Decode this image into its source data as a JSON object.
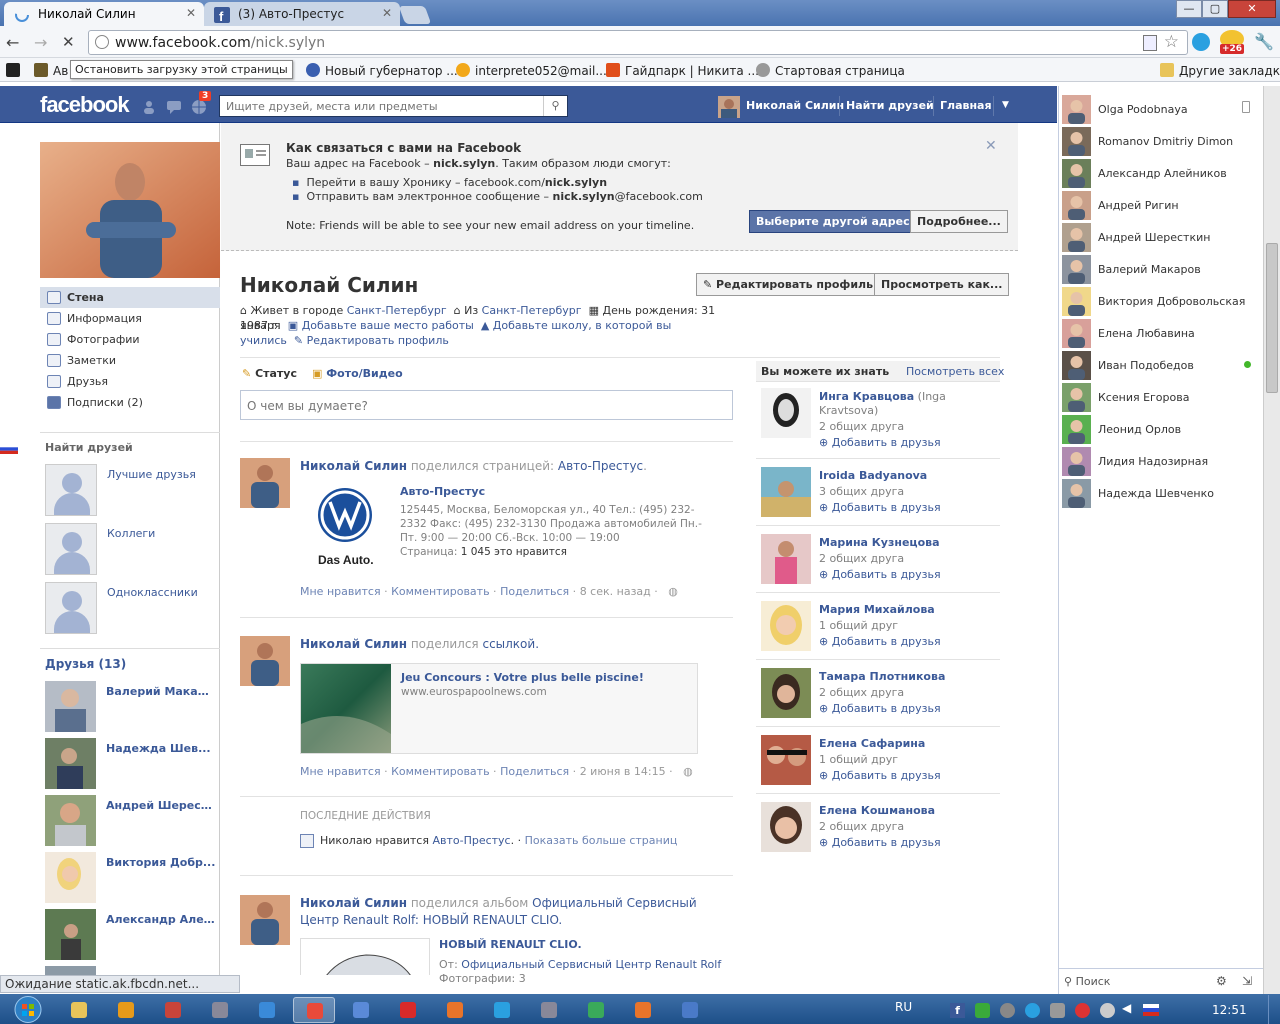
{
  "browser": {
    "tabs": [
      {
        "title": "Николай Силин"
      },
      {
        "title": "(3) Авто-Престус"
      }
    ],
    "url_host": "www.facebook.com",
    "url_path": "/nick.sylyn",
    "tooltip": "Остановить загрузку этой страницы",
    "badge": "+26",
    "bookmarks": [
      {
        "label": "Ав",
        "icon": "wordmark-icon"
      },
      {
        "label": "ин",
        "icon": "page-icon"
      },
      {
        "label": "Новый губернатор ...",
        "icon": "eye-icon"
      },
      {
        "label": "interprete052@mail....",
        "icon": "mail-icon"
      },
      {
        "label": "Гайдпарк | Никита ...",
        "icon": "gaidpark-icon"
      },
      {
        "label": "Стартовая страница",
        "icon": "start-icon"
      }
    ],
    "other_bookmarks": "Другие закладки",
    "status_text": "Ожидание static.ak.fbcdn.net..."
  },
  "fb": {
    "logo": "facebook",
    "notif_count": "3",
    "search_placeholder": "Ищите друзей, места или предметы",
    "nav": {
      "user": "Николай Силин",
      "find_friends": "Найти друзей",
      "home": "Главная"
    }
  },
  "left": {
    "nav": [
      {
        "label": "Стена"
      },
      {
        "label": "Информация"
      },
      {
        "label": "Фотографии"
      },
      {
        "label": "Заметки"
      },
      {
        "label": "Друзья"
      },
      {
        "label": "Подписки (2)"
      }
    ],
    "find_friends_heading": "Найти друзей",
    "lists": [
      {
        "label": "Лучшие друзья"
      },
      {
        "label": "Коллеги"
      },
      {
        "label": "Одноклассники"
      }
    ],
    "friends_heading": "Друзья (13)",
    "friends": [
      {
        "name": "Валерий Макаров"
      },
      {
        "name": "Надежда Шев..."
      },
      {
        "name": "Андрей Шерест..."
      },
      {
        "name": "Виктория Добр..."
      },
      {
        "name": "Александр Але..."
      }
    ]
  },
  "notice": {
    "title": "Как связаться с вами на Facebook",
    "line1_pre": "Ваш адрес на Facebook – ",
    "line1_bold": "nick.sylyn",
    "line1_post": ". Таким образом люди смогут:",
    "bullet1_pre": "Перейти в вашу Хронику – facebook.com/",
    "bullet1_bold": "nick.sylyn",
    "bullet2_pre": "Отправить вам электронное сообщение – ",
    "bullet2_bold": "nick.sylyn",
    "bullet2_post": "@facebook.com",
    "note": "Note: Friends will be able to see your new email address on your timeline.",
    "btn_other": "Выберите другой адрес",
    "btn_more": "Подробнее..."
  },
  "profile": {
    "name": "Николай Силин",
    "edit_btn": "Редактировать профиль",
    "view_btn": "Просмотреть как...",
    "lives_pre": "Живет в городе ",
    "lives_city": "Санкт-Петербург",
    "from_pre": "Из ",
    "from_city": "Санкт-Петербург",
    "birthday": "День рождения: 31 января",
    "year": "1987 г.",
    "add_work": "Добавьте ваше место работы",
    "add_school_1": "Добавьте школу, в которой вы",
    "add_school_2": "учились",
    "edit_profile": "Редактировать профиль"
  },
  "composer": {
    "tab_status": "Статус",
    "tab_photo": "Фото/Видео",
    "placeholder": "О чем вы думаете?"
  },
  "posts": [
    {
      "actor": "Николай Силин",
      "verb": " поделился страницей: ",
      "object": "Авто-Престус",
      "attach_title": "Авто-Престус",
      "attach_text": "125445, Москва, Беломорская ул., 40 Тел.: (495) 232-2332 Факс: (495) 232-3130 Продажа автомобилей Пн.-Пт. 9:00 — 20:00 Сб.-Вск. 10:00 — 19:00",
      "attach_page_pre": "Страница: ",
      "attach_page": "1 045 это нравится",
      "logo_text": "Das Auto.",
      "like": "Мне нравится",
      "comment": "Комментировать",
      "share": "Поделиться",
      "time": "8 сек. назад"
    },
    {
      "actor": "Николай Силин",
      "verb": " поделился ",
      "object": "ссылкой.",
      "attach_title": "Jeu Concours : Votre plus belle piscine!",
      "attach_url": "www.eurospapoolnews.com",
      "like": "Мне нравится",
      "comment": "Комментировать",
      "share": "Поделиться",
      "time": "2 июня в 14:15"
    },
    {
      "actor": "Николай Силин",
      "verb": " поделился альбом ",
      "object": "Официальный Сервисный Центр Renault Rolf: НОВЫЙ RENAULT CLIO.",
      "object_l1": "Официальный Сервисный",
      "object_l2": "Центр Renault Rolf: НОВЫЙ RENAULT CLIO.",
      "attach_title": "НОВЫЙ RENAULT CLIO.",
      "from_pre": "От: ",
      "from": "Официальный Сервисный Центр Renault Rolf",
      "photos": "Фотографии: 3"
    }
  ],
  "recent": {
    "heading": "ПОСЛЕДНИЕ ДЕЙСТВИЯ",
    "text_pre": "Николаю нравится ",
    "text_link": "Авто-Престус",
    "text_dot": ".",
    "more": "Показать больше страниц"
  },
  "suggestions": {
    "heading": "Вы можете их знать",
    "see_all": "Посмотреть всех",
    "add_label": "Добавить в друзья",
    "people": [
      {
        "name": "Инга Кравцова",
        "alt": " (Inga",
        "alt2": "Kravtsova)",
        "mutual": "2 общих друга"
      },
      {
        "name": "Iroida Badyanova",
        "mutual": "3 общих друга"
      },
      {
        "name": "Марина Кузнецова",
        "mutual": "2 общих друга"
      },
      {
        "name": "Мария Михайлова",
        "mutual": "1 общий друг"
      },
      {
        "name": "Тамара Плотникова",
        "mutual": "2 общих друга"
      },
      {
        "name": "Елена Сафарина",
        "mutual": "1 общий друг"
      },
      {
        "name": "Елена Кошманова",
        "mutual": "2 общих друга"
      }
    ]
  },
  "chat": {
    "people": [
      {
        "name": "Olga Podobnaya"
      },
      {
        "name": "Romanov Dmitriy Dimon"
      },
      {
        "name": "Александр Алейников"
      },
      {
        "name": "Андрей Ригин"
      },
      {
        "name": "Андрей Шерeсткин"
      },
      {
        "name": "Валерий Макаров"
      },
      {
        "name": "Виктория Добровольская"
      },
      {
        "name": "Елена Любавина"
      },
      {
        "name": "Иван Подобедов"
      },
      {
        "name": "Ксения Егорова"
      },
      {
        "name": "Леонид Орлов"
      },
      {
        "name": "Лидия Надозирная"
      },
      {
        "name": "Надежда Шевченко"
      }
    ],
    "search": "Поиск"
  },
  "taskbar": {
    "lang": "RU",
    "time": "12:51"
  },
  "colors": {
    "fb_blue": "#3b5998",
    "fb_dark": "#133783",
    "link": "#3b5998",
    "online": "#42b72a"
  }
}
